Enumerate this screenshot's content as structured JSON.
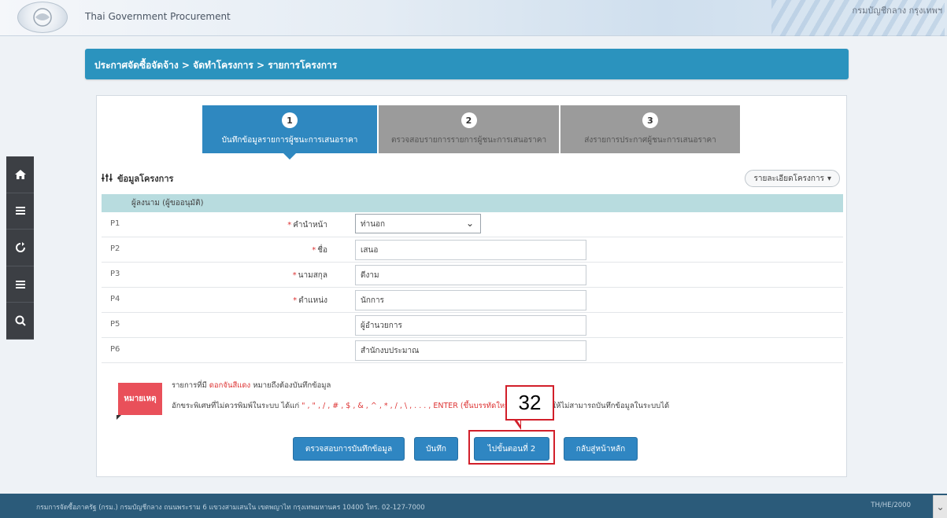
{
  "header": {
    "site_title": "Thai Government Procurement",
    "user_text": "กรมบัญชีกลาง กรุงเทพฯ"
  },
  "left_tools": [
    {
      "icon": "home-icon"
    },
    {
      "icon": "menu-icon"
    },
    {
      "icon": "refresh-icon"
    },
    {
      "icon": "menu-icon"
    },
    {
      "icon": "search-icon"
    }
  ],
  "breadcrumb": "ประกาศจัดซื้อจัดจ้าง > จัดทำโครงการ > รายการโครงการ",
  "steps": [
    {
      "num": "1",
      "label": "บันทึกข้อมูลรายการผู้ชนะการเสนอราคา"
    },
    {
      "num": "2",
      "label": "ตรวจสอบรายการรายการผู้ชนะการเสนอราคา"
    },
    {
      "num": "3",
      "label": "ส่งรายการประกาศผู้ชนะการเสนอราคา"
    }
  ],
  "section": {
    "title": "ข้อมูลโครงการ",
    "detail_button": "รายละเอียดโครงการ"
  },
  "sub_header": "ผู้ลงนาม (ผู้ขออนุมัติ)",
  "rows": [
    {
      "code": "P1",
      "label": "คำนำหน้า",
      "value": "ท่านอก",
      "type": "select"
    },
    {
      "code": "P2",
      "label": "ชื่อ",
      "value": "เสนอ",
      "type": "text"
    },
    {
      "code": "P3",
      "label": "นามสกุล",
      "value": "ดีงาม",
      "type": "text"
    },
    {
      "code": "P4",
      "label": "ตำแหน่ง",
      "value": "นักการ",
      "type": "text"
    },
    {
      "code": "P5",
      "label": "",
      "value": "ผู้อำนวยการ",
      "type": "text"
    },
    {
      "code": "P6",
      "label": "",
      "value": "สำนักงบประมาณ",
      "type": "text"
    }
  ],
  "note": {
    "label": "หมายเหตุ",
    "line1_prefix": "รายการที่มี",
    "line1_red": "ดอกจันสีแดง",
    "line1_suffix": "หมายถึงต้องบันทึกข้อมูล",
    "line2_prefix": "อักขระพิเศษที่ไม่ควรพิมพ์ในระบบ ได้แก่",
    "line2_red": "\" , \" , / , # , $ , & , ^ , * , / , \\ , . . . , ENTER (ขึ้นบรรทัดใหม่)",
    "line2_suffix": "เพราะจะทำให้ไม่สามารถบันทึกข้อมูลในระบบได้"
  },
  "buttons": {
    "check": "ตรวจสอบการบันทึกข้อมูล",
    "save": "บันทึก",
    "next": "ไปขั้นตอนที่ 2",
    "home": "กลับสู่หน้าหลัก"
  },
  "callout": "32",
  "footer": {
    "text": "กรมการจัดซื้อภาครัฐ (กรม.) กรมบัญชีกลาง ถนนพระราม 6 แขวงสามเสนใน เขตพญาไท กรุงเทพมหานคร 10400 โทร. 02-127-7000",
    "right": "TH/HE/2000"
  },
  "colors": {
    "primary": "#2f88c0",
    "breadcrumb_bg": "#2b93be",
    "highlight": "#d21f2a",
    "note_bg": "#e9505a",
    "sub_header_bg": "#b8dcdf"
  }
}
